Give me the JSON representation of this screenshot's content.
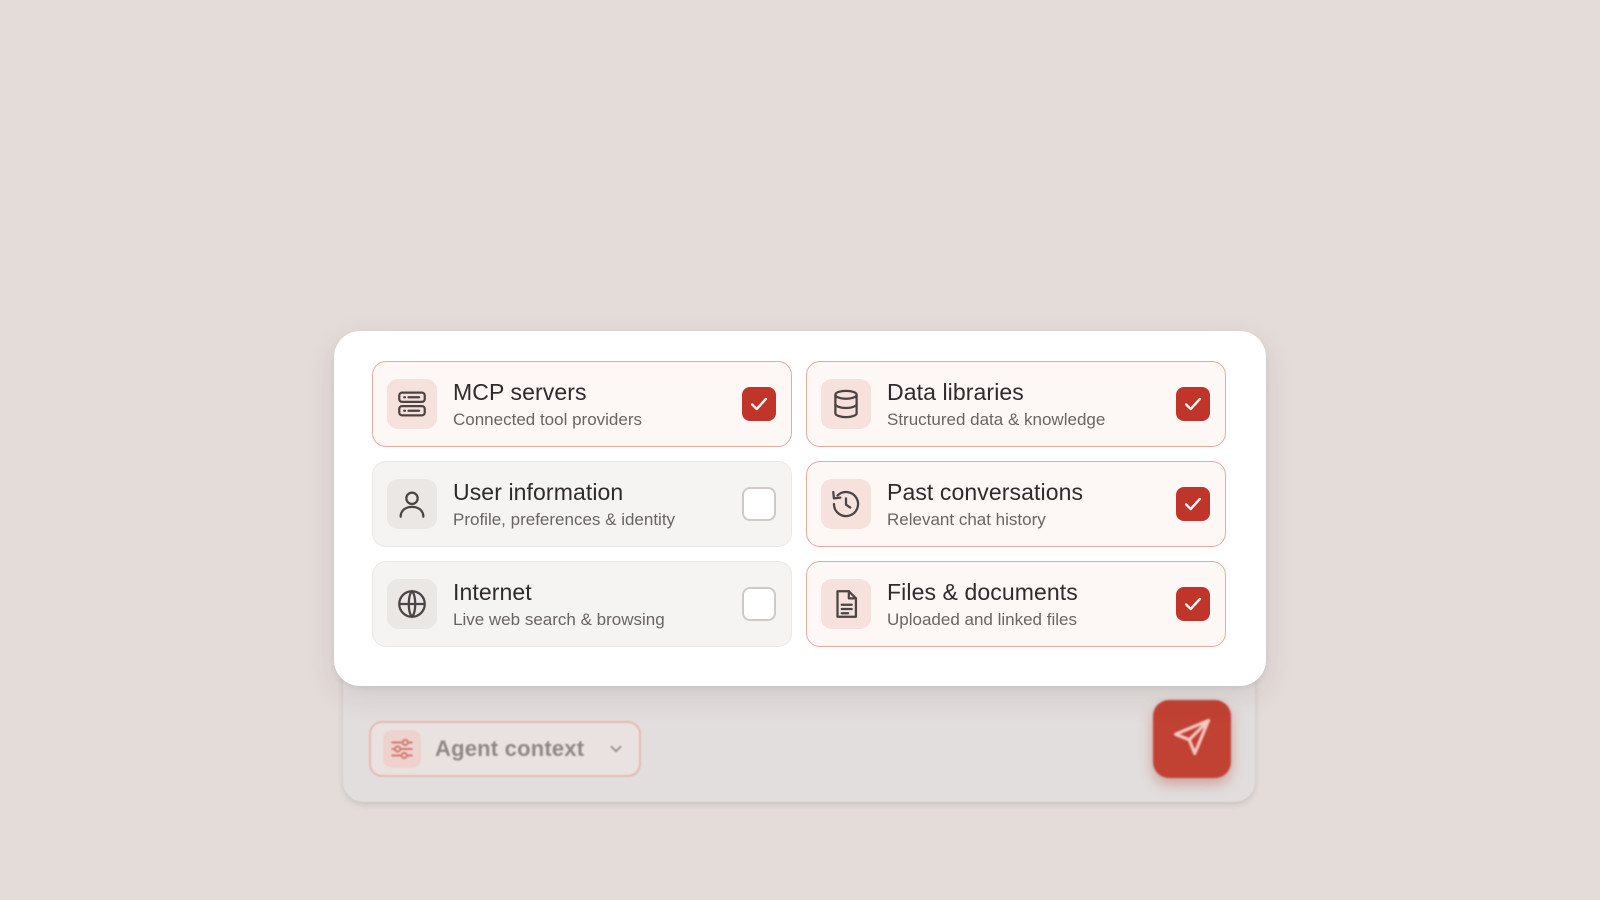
{
  "colors": {
    "background": "#e4dcd9",
    "accent": "#c0342a",
    "panel": "#ffffff"
  },
  "context_options": [
    {
      "title": "MCP servers",
      "subtitle": "Connected tool providers",
      "icon": "server-icon",
      "checked": true
    },
    {
      "title": "Data libraries",
      "subtitle": "Structured data & knowledge",
      "icon": "database-icon",
      "checked": true
    },
    {
      "title": "User information",
      "subtitle": "Profile, preferences & identity",
      "icon": "user-icon",
      "checked": false
    },
    {
      "title": "Past conversations",
      "subtitle": "Relevant chat history",
      "icon": "history-icon",
      "checked": true
    },
    {
      "title": "Internet",
      "subtitle": "Live web search & browsing",
      "icon": "globe-icon",
      "checked": false
    },
    {
      "title": "Files & documents",
      "subtitle": "Uploaded and linked files",
      "icon": "document-icon",
      "checked": true
    }
  ],
  "composer": {
    "context_chip_label": "Agent context",
    "context_chip_icon": "sliders-icon",
    "dropdown_icon": "chevron-down-icon",
    "send_icon": "send-icon"
  }
}
